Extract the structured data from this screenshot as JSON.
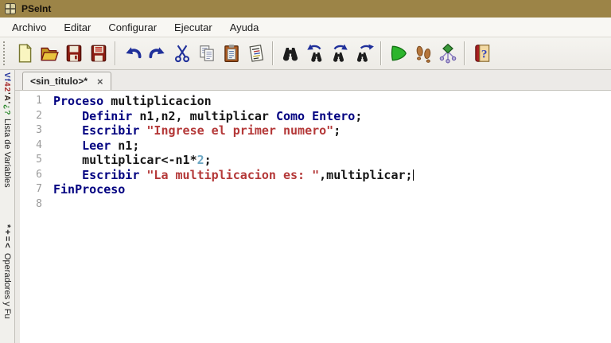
{
  "window": {
    "title": "PSeInt"
  },
  "menu": {
    "items": [
      "Archivo",
      "Editar",
      "Configurar",
      "Ejecutar",
      "Ayuda"
    ]
  },
  "toolbar": {
    "icons": [
      "new-file",
      "open-file",
      "save-file",
      "save-all",
      "undo",
      "redo",
      "cut",
      "copy",
      "paste",
      "fix-indent",
      "find",
      "find-previous",
      "find-next",
      "replace",
      "run",
      "step-run",
      "draw-flowchart",
      "help"
    ]
  },
  "tabs": [
    {
      "label": "<sin_titulo>*",
      "close_glyph": "×"
    }
  ],
  "sidebar": {
    "variables_glyphs": [
      "Vf",
      "42",
      "'A'",
      "¿?"
    ],
    "variables_label": "Lista de Variables",
    "operators_glyphs": "*+=<",
    "operators_label": "Operadores y Fu"
  },
  "editor": {
    "lines": [
      {
        "num": "1",
        "segments": [
          {
            "t": "Proceso",
            "c": "kw"
          },
          {
            "t": " multiplicacion",
            "c": "id"
          }
        ]
      },
      {
        "num": "2",
        "segments": [
          {
            "t": "    ",
            "c": "id"
          },
          {
            "t": "Definir",
            "c": "kw"
          },
          {
            "t": " n1,n2, multiplicar ",
            "c": "id"
          },
          {
            "t": "Como Entero",
            "c": "kw"
          },
          {
            "t": ";",
            "c": "id"
          }
        ]
      },
      {
        "num": "3",
        "segments": [
          {
            "t": "    ",
            "c": "id"
          },
          {
            "t": "Escribir",
            "c": "kw"
          },
          {
            "t": " ",
            "c": "id"
          },
          {
            "t": "\"Ingrese el primer numero\"",
            "c": "str"
          },
          {
            "t": ";",
            "c": "id"
          }
        ]
      },
      {
        "num": "4",
        "segments": [
          {
            "t": "    ",
            "c": "id"
          },
          {
            "t": "Leer",
            "c": "kw"
          },
          {
            "t": " n1;",
            "c": "id"
          }
        ]
      },
      {
        "num": "5",
        "segments": [
          {
            "t": "    multiplicar<-n1*",
            "c": "id"
          },
          {
            "t": "2",
            "c": "num"
          },
          {
            "t": ";",
            "c": "id"
          }
        ]
      },
      {
        "num": "6",
        "segments": [
          {
            "t": "    ",
            "c": "id"
          },
          {
            "t": "Escribir",
            "c": "kw"
          },
          {
            "t": " ",
            "c": "id"
          },
          {
            "t": "\"La multiplicacion es: \"",
            "c": "str"
          },
          {
            "t": ",multiplicar;",
            "c": "id"
          },
          {
            "c": "caret"
          }
        ]
      },
      {
        "num": "7",
        "segments": [
          {
            "t": "FinProceso",
            "c": "kw"
          }
        ]
      },
      {
        "num": "8",
        "segments": []
      }
    ]
  },
  "colors": {
    "titlebar": "#9c8447",
    "keyword": "#000080",
    "string": "#b43838",
    "number": "#6fa8c4",
    "glyphBlue": "#2b3ba0",
    "glyphRed": "#a83030",
    "glyphDark": "#30241c",
    "glyphGreen": "#2f8a2f"
  }
}
